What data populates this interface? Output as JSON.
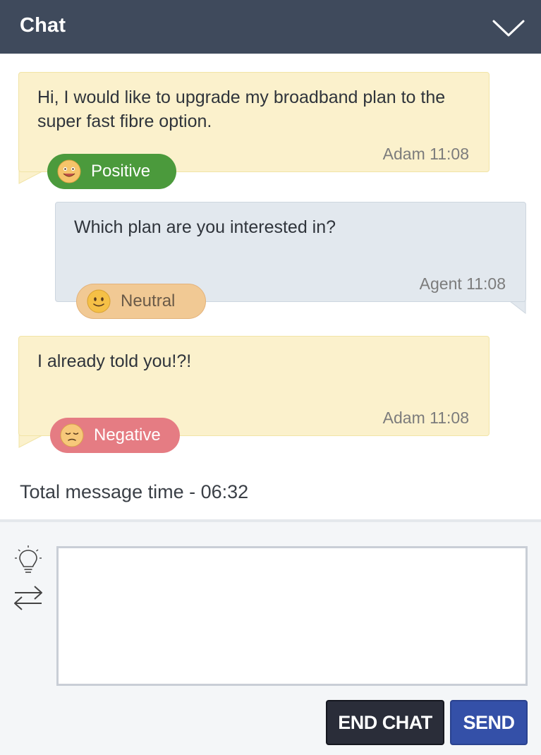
{
  "header": {
    "title": "Chat",
    "collapse_icon": "chevron-down-icon"
  },
  "messages": [
    {
      "role": "customer",
      "text": "Hi, I would like to upgrade my broadband plan to the super fast fibre option.",
      "meta": "Adam 11:08",
      "sentiment": "Positive",
      "sentiment_icon": "smile-face-icon"
    },
    {
      "role": "agent",
      "text": "Which plan are you interested in?",
      "meta": "Agent 11:08",
      "sentiment": "Neutral",
      "sentiment_icon": "neutral-face-icon"
    },
    {
      "role": "customer",
      "text": "I already told you!?!",
      "meta": "Adam 11:08",
      "sentiment": "Negative",
      "sentiment_icon": "sad-face-icon"
    }
  ],
  "summary": {
    "total_time": "Total message time - 06:32"
  },
  "composer": {
    "value": "",
    "placeholder": "",
    "end_chat_label": "END CHAT",
    "send_label": "SEND"
  },
  "colors": {
    "header_bg": "#3f4a5c",
    "customer_bubble": "#fbf1cc",
    "agent_bubble": "#e2e8ee",
    "positive": "#4b9a3c",
    "neutral": "#f1c994",
    "negative": "#e57c83",
    "end_chat": "#2a2d39",
    "send": "#3450a8"
  }
}
